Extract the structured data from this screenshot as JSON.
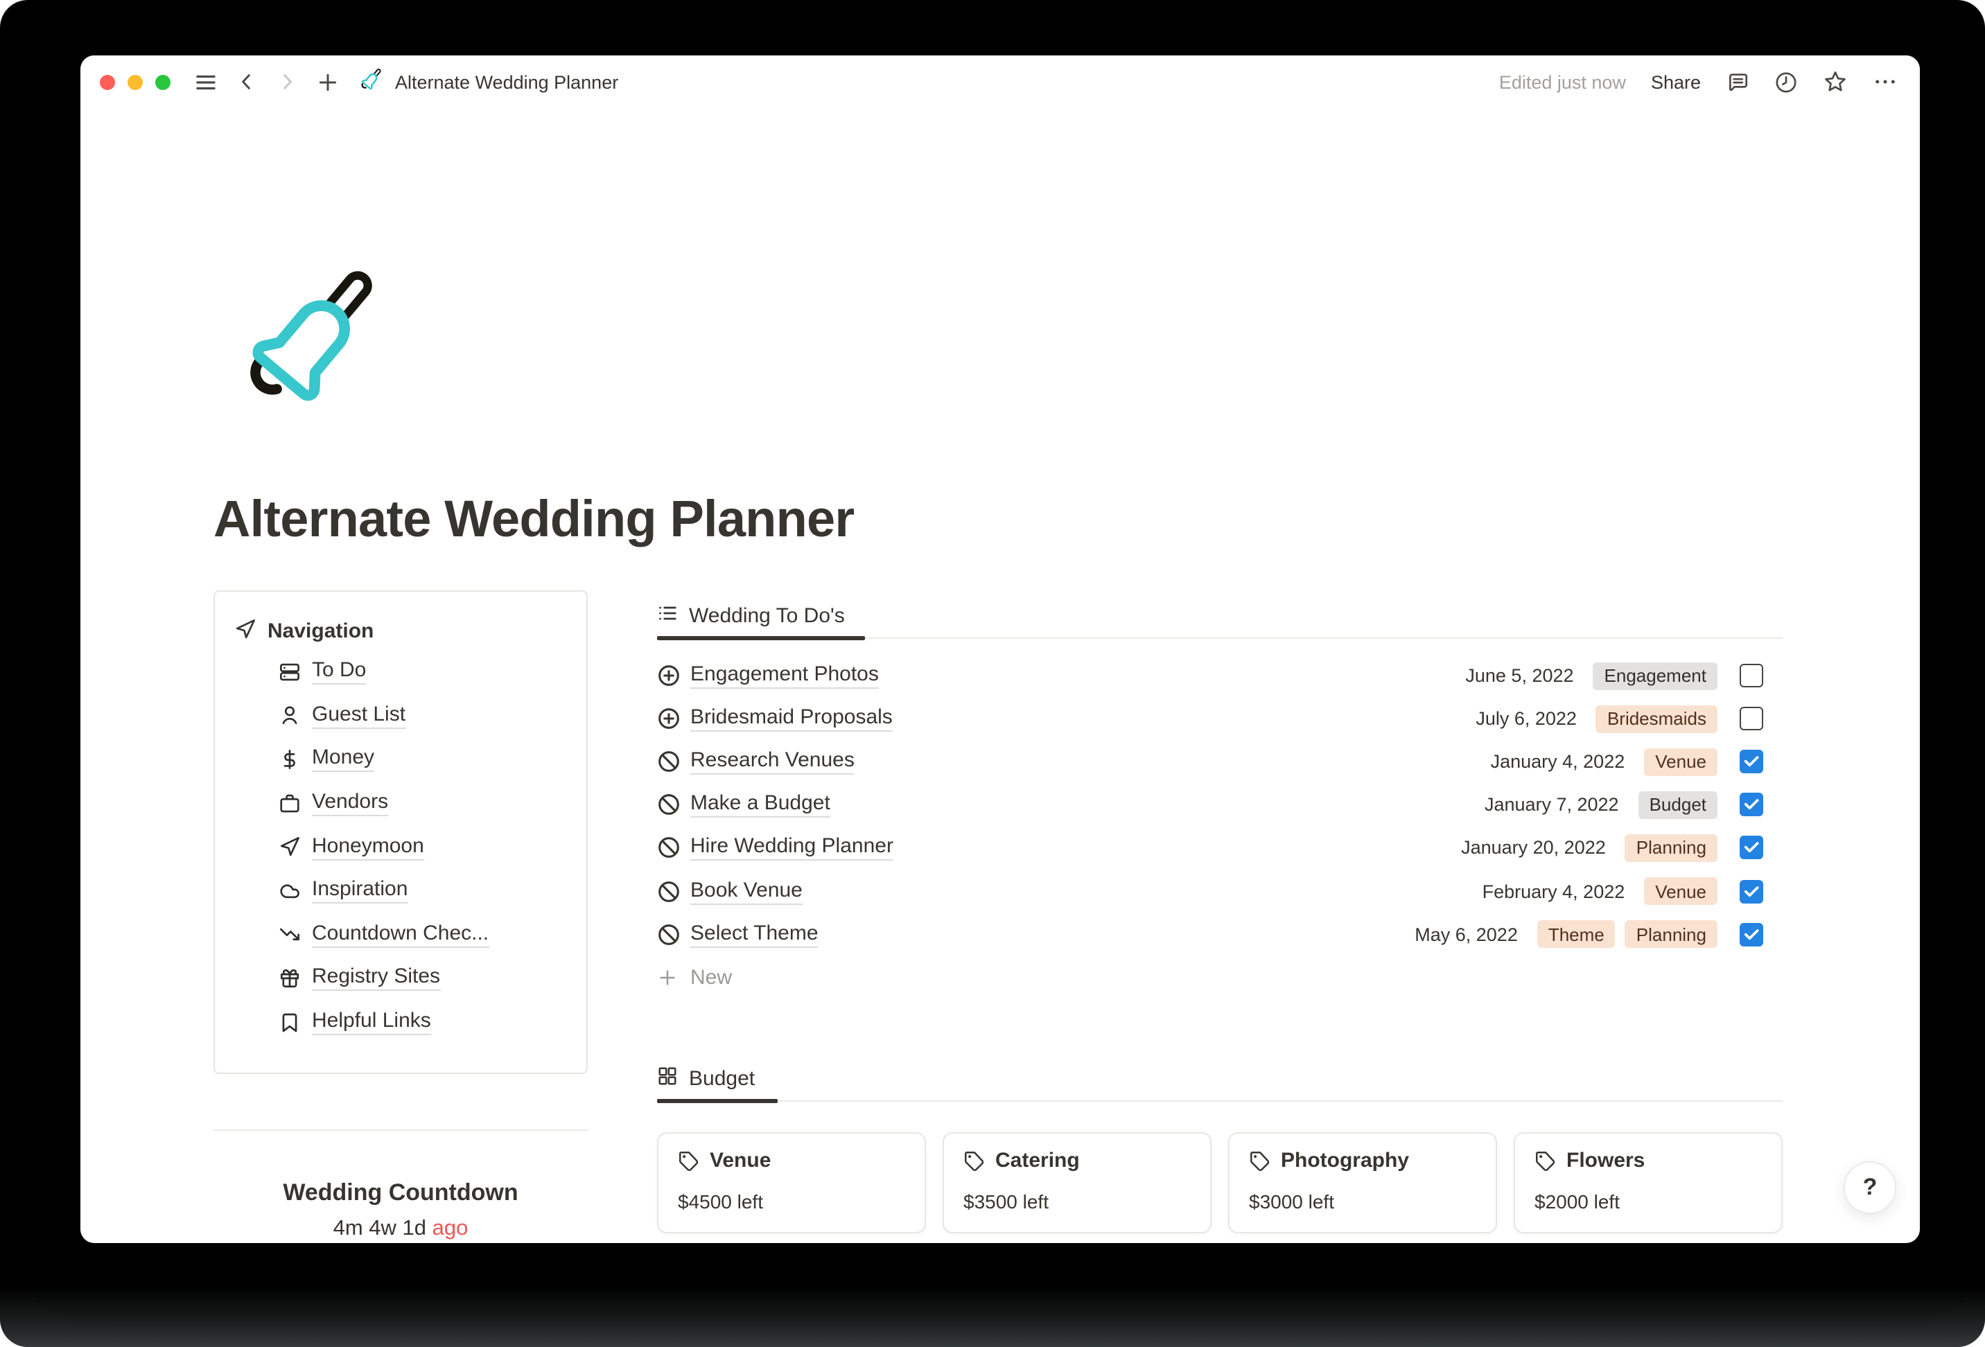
{
  "titlebar": {
    "title": "Alternate Wedding Planner",
    "edited_status": "Edited just now",
    "share_label": "Share",
    "window_controls": [
      "close",
      "minimize",
      "zoom"
    ],
    "icons": [
      "menu-icon",
      "chevron-left-icon",
      "chevron-right-icon",
      "plus-icon",
      "bell-icon",
      "comments-icon",
      "history-icon",
      "favorite-star-icon",
      "more-icon"
    ]
  },
  "page": {
    "emoji_icon": "bell-icon",
    "title": "Alternate Wedding Planner",
    "navigation": {
      "header": "Navigation",
      "header_icon": "paper-plane-icon",
      "items": [
        {
          "icon": "server",
          "label": "To Do"
        },
        {
          "icon": "user",
          "label": "Guest List"
        },
        {
          "icon": "dollar",
          "label": "Money"
        },
        {
          "icon": "briefcase",
          "label": "Vendors"
        },
        {
          "icon": "paper-plane",
          "label": "Honeymoon"
        },
        {
          "icon": "cloud",
          "label": "Inspiration"
        },
        {
          "icon": "trending-down",
          "label": "Countdown Chec..."
        },
        {
          "icon": "gift",
          "label": "Registry Sites"
        },
        {
          "icon": "bookmark",
          "label": "Helpful Links"
        }
      ]
    },
    "countdown": {
      "title": "Wedding Countdown",
      "value": "4m 4w 1d",
      "suffix": "ago"
    },
    "todos": {
      "tab_label": "Wedding To Do's",
      "tab_icon": "list-icon",
      "rows": [
        {
          "icon": "circle-plus",
          "task": "Engagement Photos",
          "date": "June 5, 2022",
          "tags": [
            {
              "label": "Engagement",
              "color": "gray"
            }
          ],
          "done": false
        },
        {
          "icon": "circle-plus",
          "task": "Bridesmaid Proposals",
          "date": "July 6, 2022",
          "tags": [
            {
              "label": "Bridesmaids",
              "color": "peach"
            }
          ],
          "done": false
        },
        {
          "icon": "circle-slash",
          "task": "Research Venues",
          "date": "January 4, 2022",
          "tags": [
            {
              "label": "Venue",
              "color": "peach"
            }
          ],
          "done": true
        },
        {
          "icon": "circle-slash",
          "task": "Make a Budget",
          "date": "January 7, 2022",
          "tags": [
            {
              "label": "Budget",
              "color": "gray"
            }
          ],
          "done": true
        },
        {
          "icon": "circle-slash",
          "task": "Hire Wedding Planner",
          "date": "January 20, 2022",
          "tags": [
            {
              "label": "Planning",
              "color": "peach"
            }
          ],
          "done": true
        },
        {
          "icon": "circle-slash",
          "task": "Book Venue",
          "date": "February 4, 2022",
          "tags": [
            {
              "label": "Venue",
              "color": "peach"
            }
          ],
          "done": true
        },
        {
          "icon": "circle-slash",
          "task": "Select Theme",
          "date": "May 6, 2022",
          "tags": [
            {
              "label": "Theme",
              "color": "peach"
            },
            {
              "label": "Planning",
              "color": "peach"
            }
          ],
          "done": true
        }
      ],
      "new_label": "New"
    },
    "budget": {
      "tab_label": "Budget",
      "tab_icon": "grid-icon",
      "cards": [
        {
          "icon": "tag",
          "name": "Venue",
          "remaining": "$4500 left"
        },
        {
          "icon": "tag",
          "name": "Catering",
          "remaining": "$3500 left"
        },
        {
          "icon": "tag",
          "name": "Photography",
          "remaining": "$3000 left"
        },
        {
          "icon": "tag",
          "name": "Flowers",
          "remaining": "$2000 left"
        }
      ]
    },
    "help_label": "?"
  },
  "colors": {
    "accent_teal": "#38C7CC",
    "checkbox_blue": "#2383E2",
    "overdue_red": "#EB5757",
    "traffic_red": "#FF5F57",
    "traffic_yellow": "#FEBC2E",
    "traffic_green": "#29C73F",
    "tag_gray_bg": "#E3E2E0",
    "tag_peach_bg": "#FAE2D1",
    "text_primary": "#37352F"
  }
}
